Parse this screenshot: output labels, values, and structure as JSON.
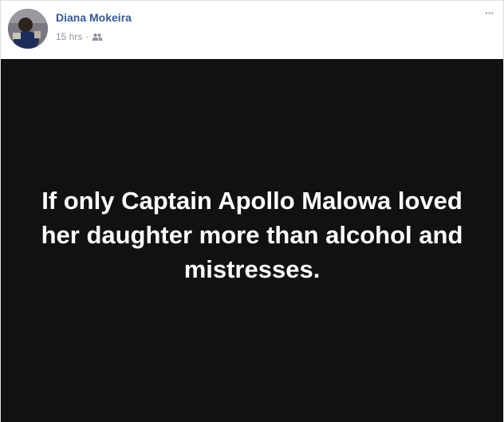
{
  "post": {
    "author": "Diana Mokeira",
    "timestamp": "15 hrs",
    "separator": "·",
    "audience_icon": "friends-icon",
    "more_icon": "ellipsis-icon",
    "more_label": "···",
    "text": "If only Captain Apollo Malowa loved her daughter more than alcohol and mistresses.",
    "background_color": "#111111",
    "text_color": "#ffffff",
    "author_color": "#365899"
  }
}
